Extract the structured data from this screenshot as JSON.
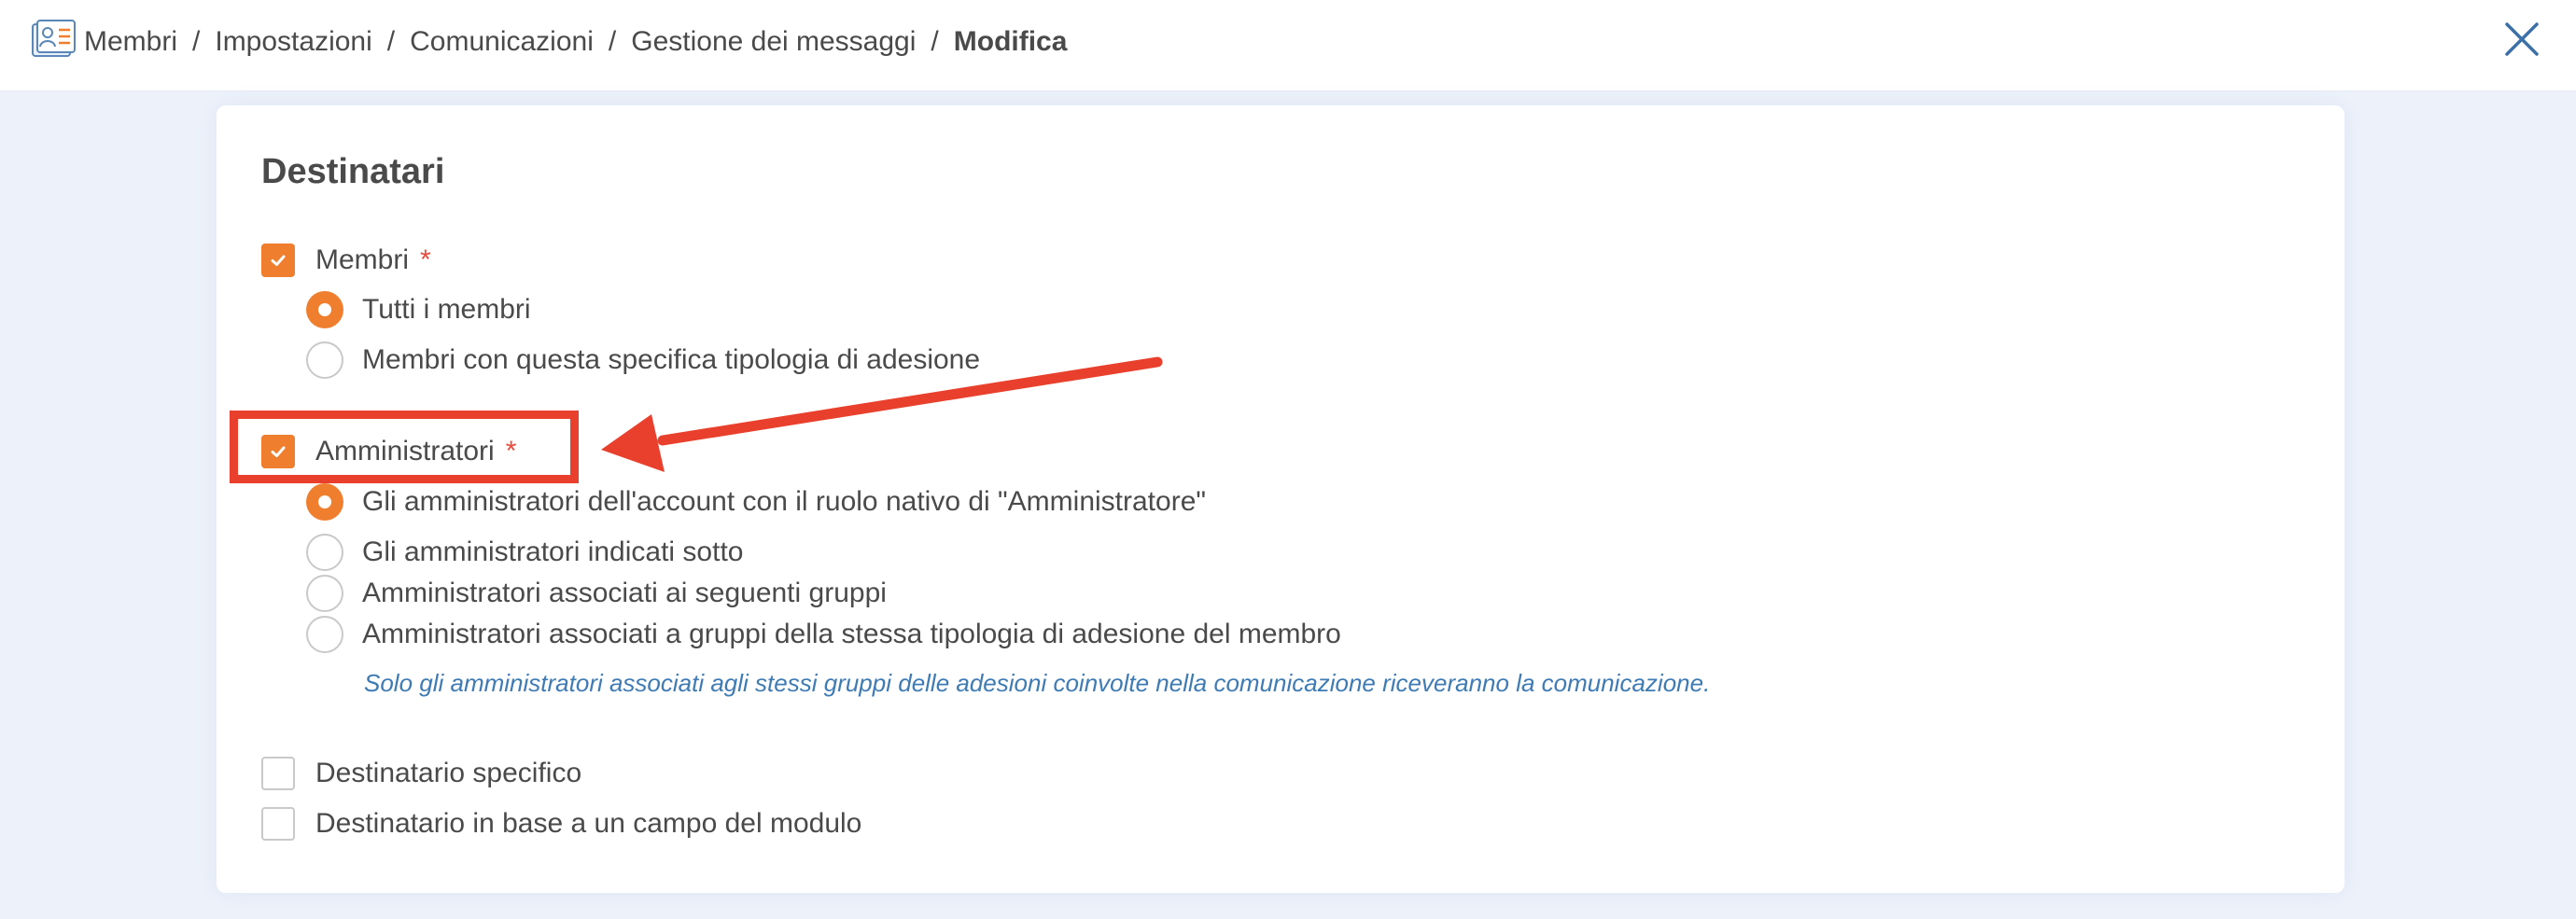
{
  "breadcrumb": {
    "items": [
      "Membri",
      "Impostazioni",
      "Comunicazioni",
      "Gestione dei messaggi"
    ],
    "separator": "/",
    "current": "Modifica"
  },
  "icons": {
    "app": "member-card-icon",
    "close": "close-icon"
  },
  "colors": {
    "accent": "#ef7e2f",
    "required": "#e84a3c",
    "hint": "#3e7bb5",
    "annotation": "#e8402c",
    "close": "#3d6fa8"
  },
  "recipients": {
    "title": "Destinatari",
    "required_marker": "*",
    "members": {
      "label": "Membri",
      "checked": true,
      "options": [
        {
          "label": "Tutti i membri",
          "selected": true
        },
        {
          "label": "Membri con questa specifica tipologia di adesione",
          "selected": false
        }
      ]
    },
    "admins": {
      "label": "Amministratori",
      "checked": true,
      "options": [
        {
          "label": "Gli amministratori dell'account con il ruolo nativo di \"Amministratore\"",
          "selected": true
        },
        {
          "label": "Gli amministratori indicati sotto",
          "selected": false
        },
        {
          "label": "Amministratori associati ai seguenti gruppi",
          "selected": false
        },
        {
          "label": "Amministratori associati a gruppi della stessa tipologia di adesione del membro",
          "selected": false
        }
      ],
      "hint": "Solo gli amministratori associati agli stessi gruppi delle adesioni coinvolte nella comunicazione riceveranno la comunicazione."
    },
    "specific_recipient": {
      "label": "Destinatario specifico",
      "checked": false
    },
    "form_field_recipient": {
      "label": "Destinatario in base a un campo del modulo",
      "checked": false
    }
  }
}
